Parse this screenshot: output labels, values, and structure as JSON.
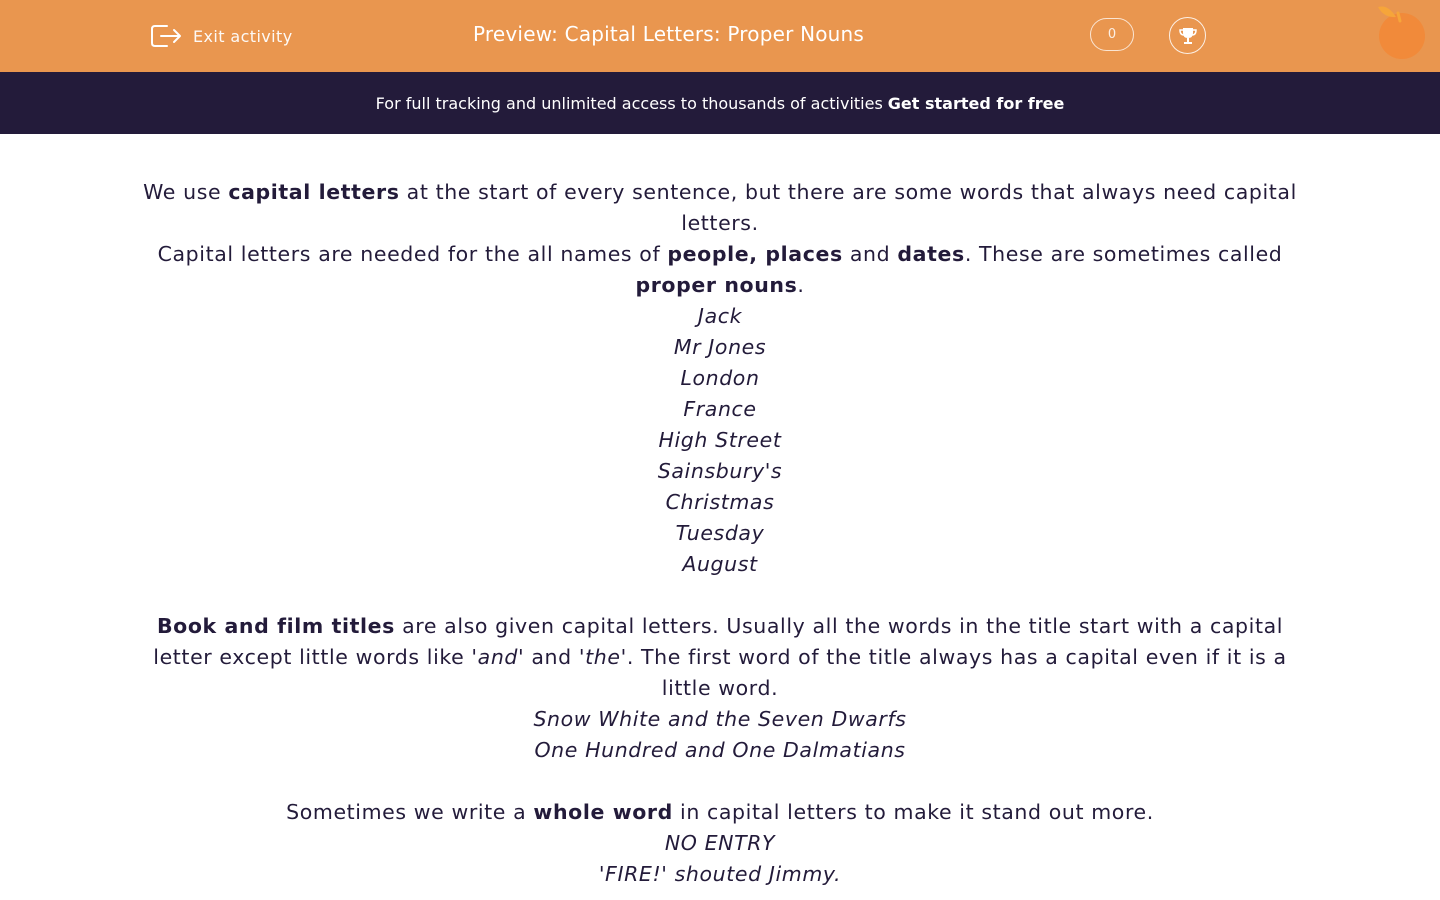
{
  "header": {
    "exit_label": "Exit activity",
    "title": "Preview: Capital Letters: Proper Nouns",
    "score": "0",
    "brand_color": "#e9964f"
  },
  "banner": {
    "text": "For full tracking and unlimited access to thousands of activities",
    "cta": "Get started for free",
    "background": "#231b3a"
  },
  "lesson": {
    "intro": {
      "p1_pre": "We use ",
      "p1_bold": "capital letters",
      "p1_post": " at the start of every sentence, but there are some words that always need capital letters.",
      "p2_pre": "Capital letters are needed for the all names of ",
      "p2_bold1": "people, places",
      "p2_mid": " and ",
      "p2_bold2": "dates",
      "p2_post": ". These are sometimes called ",
      "p2_bold3": "proper nouns",
      "p2_end": "."
    },
    "examples": [
      "Jack",
      "Mr Jones",
      "London",
      "France",
      "High Street",
      "Sainsbury's",
      "Christmas",
      "Tuesday",
      "August"
    ],
    "titles": {
      "bold": "Book and film titles",
      "text1": " are also given capital letters. Usually all the words in the title start with a capital letter except little words like '",
      "em1": "and",
      "text2": "' and '",
      "em2": "the",
      "text3": "'. The first word of the title always has a capital even if it is a little word.",
      "examples": [
        "Snow White and the Seven Dwarfs",
        "One Hundred and One Dalmatians"
      ]
    },
    "whole_word": {
      "pre": "Sometimes we write a ",
      "bold": "whole word",
      "post": " in capital letters to make it stand out more.",
      "examples": [
        "NO ENTRY",
        "'FIRE!' shouted Jimmy."
      ]
    }
  }
}
